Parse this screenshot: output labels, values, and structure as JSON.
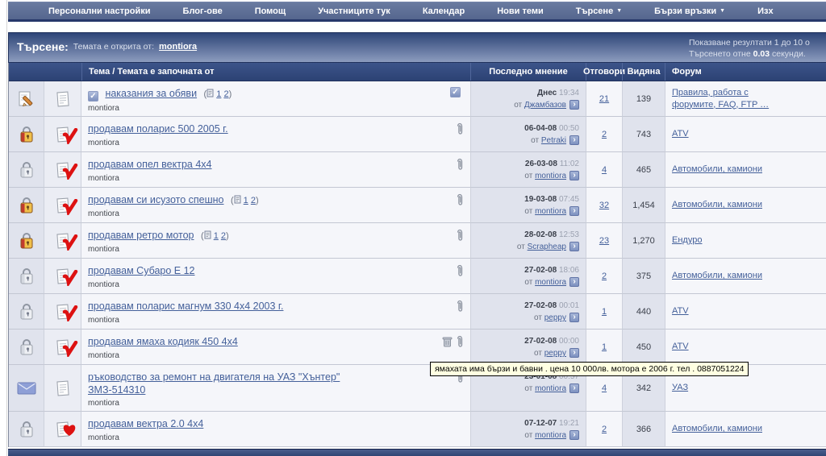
{
  "colors": {
    "accent": "#31487A",
    "navbar": "#5C6D94",
    "link": "#44609A",
    "alt_light": "#F5F6FA",
    "alt_dark": "#E0E3ED",
    "tooltip_bg": "#FFFFE1",
    "mark_red": "#DD1111"
  },
  "nav": {
    "items": [
      {
        "label": "Персонални настройки",
        "dropdown": false
      },
      {
        "label": "Блог-ове",
        "dropdown": false
      },
      {
        "label": "Помощ",
        "dropdown": false
      },
      {
        "label": "Участниците тук",
        "dropdown": false
      },
      {
        "label": "Календар",
        "dropdown": false
      },
      {
        "label": "Нови теми",
        "dropdown": false
      },
      {
        "label": "Търсене",
        "dropdown": true
      },
      {
        "label": "Бързи връзки",
        "dropdown": true
      },
      {
        "label": "Изх",
        "dropdown": false
      }
    ]
  },
  "search_header": {
    "title": "Търсене:",
    "subtitle": "Темата е открита от:",
    "subject_user": "montiora",
    "results_line": "Показване резултати 1 до 10 о",
    "time_prefix": "Търсенето отне",
    "time_value": "0.03",
    "time_suffix": "секунди."
  },
  "table_headers": {
    "topic": "Тема / Темата е започната от",
    "last_post": "Последно мнение",
    "replies": "Отговори",
    "views": "Видяна",
    "forum": "Форум"
  },
  "labels": {
    "by": "от",
    "pages_open": "(",
    "pages_close": ")"
  },
  "tooltip": {
    "text": "ямахата има бързи и бавни . цена 10 000лв.  мотора е 2006 г. тел . 0887051224"
  },
  "rows": [
    {
      "icon": "page-pencil",
      "mark": null,
      "checkbox": true,
      "check_right": true,
      "title": "наказания за обяви",
      "pages": true,
      "page1": "1",
      "page2": "2",
      "starter": "montiora",
      "date": "Днес",
      "time": "19:34",
      "by": "Джамбазов",
      "replies": "21",
      "views": "139",
      "forum": "Правила, работа с форумите, FAQ, FTP …"
    },
    {
      "icon": "bag-hot",
      "mark": "check",
      "paperclip": true,
      "title": "продавам поларис 500 2005 г.",
      "starter": "montiora",
      "date": "06-04-08",
      "time": "00:50",
      "by": "Petraki",
      "replies": "2",
      "views": "743",
      "forum": "ATV"
    },
    {
      "icon": "bag",
      "mark": "check",
      "paperclip": true,
      "title": "продавам опел вектра 4x4",
      "starter": "montiora",
      "date": "26-03-08",
      "time": "11:02",
      "by": "montiora",
      "replies": "4",
      "views": "465",
      "forum": "Автомобили, камиони"
    },
    {
      "icon": "bag-hot",
      "mark": "check",
      "paperclip": true,
      "title": "продавам си исузото спешно",
      "pages": true,
      "page1": "1",
      "page2": "2",
      "starter": "montiora",
      "date": "19-03-08",
      "time": "07:45",
      "by": "montiora",
      "replies": "32",
      "views": "1,454",
      "forum": "Автомобили, камиони"
    },
    {
      "icon": "bag-hot",
      "mark": "check",
      "paperclip": true,
      "title": "продавам ретро мотор",
      "pages": true,
      "page1": "1",
      "page2": "2",
      "starter": "montiora",
      "date": "28-02-08",
      "time": "12:53",
      "by": "Scrapheap",
      "replies": "23",
      "views": "1,270",
      "forum": "Ендуро"
    },
    {
      "icon": "bag",
      "mark": "check",
      "paperclip": true,
      "title": "продавам Субаро Е 12",
      "starter": "montiora",
      "date": "27-02-08",
      "time": "18:06",
      "by": "montiora",
      "replies": "2",
      "views": "375",
      "forum": "Автомобили, камиони"
    },
    {
      "icon": "bag",
      "mark": "check",
      "paperclip": true,
      "title": "продавам поларис магнум 330 4x4 2003 г.",
      "starter": "montiora",
      "date": "27-02-08",
      "time": "00:01",
      "by": "peppy",
      "replies": "1",
      "views": "440",
      "forum": "ATV"
    },
    {
      "icon": "bag",
      "mark": "check",
      "paperclip": true,
      "trash": true,
      "title": "продавам ямаха кодияк 450 4x4",
      "starter": "montiora",
      "date": "27-02-08",
      "time": "00:00",
      "by": "peppy",
      "replies": "1",
      "views": "450",
      "forum": "ATV"
    },
    {
      "icon": "envelope",
      "mark": null,
      "paperclip": true,
      "title": "ръководство за ремонт на двигателя на УАЗ \"Хънтер\"",
      "title2": "ЗМЗ-514310",
      "starter": "montiora",
      "date": "23-01-08",
      "time": "00:57",
      "by": "montiora",
      "replies": "4",
      "views": "342",
      "forum": "УАЗ"
    },
    {
      "icon": "bag",
      "mark": "heart",
      "title": "продавам вектра 2.0 4x4",
      "starter": "montiora",
      "date": "07-12-07",
      "time": "19:21",
      "by": "montiora",
      "replies": "2",
      "views": "366",
      "forum": "Автомобили, камиони"
    }
  ]
}
